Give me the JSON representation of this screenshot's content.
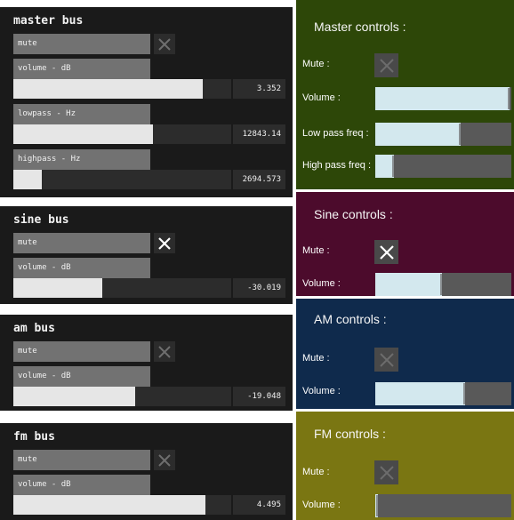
{
  "left_panels": [
    {
      "title": "master bus",
      "mute_label": "mute",
      "controls": [
        {
          "label": "volume - dB",
          "value": "3.352",
          "fill_fraction": 0.87
        },
        {
          "label": "lowpass - Hz",
          "value": "12843.14",
          "fill_fraction": 0.64
        },
        {
          "label": "highpass - Hz",
          "value": "2694.573",
          "fill_fraction": 0.13
        }
      ]
    },
    {
      "title": "sine bus",
      "mute_label": "mute",
      "controls": [
        {
          "label": "volume - dB",
          "value": "-30.019",
          "fill_fraction": 0.41
        }
      ]
    },
    {
      "title": "am bus",
      "mute_label": "mute",
      "controls": [
        {
          "label": "volume - dB",
          "value": "-19.048",
          "fill_fraction": 0.56
        }
      ]
    },
    {
      "title": "fm bus",
      "mute_label": "mute",
      "controls": [
        {
          "label": "volume - dB",
          "value": "4.495",
          "fill_fraction": 0.88
        }
      ]
    }
  ],
  "right_panels": [
    {
      "title": "Master controls :",
      "color": "#2d4708",
      "mute_label": "Mute :",
      "sliders": [
        {
          "label": "Volume :",
          "fill_fraction": 0.99
        },
        {
          "label": "Low pass freq :",
          "fill_fraction": 0.63
        },
        {
          "label": "High pass freq :",
          "fill_fraction": 0.14
        }
      ]
    },
    {
      "title": "Sine controls :",
      "color": "#4c0b2c",
      "mute_label": "Mute :",
      "sliders": [
        {
          "label": "Volume :",
          "fill_fraction": 0.49
        }
      ]
    },
    {
      "title": "AM controls :",
      "color": "#0f2a4c",
      "mute_label": "Mute :",
      "sliders": [
        {
          "label": "Volume :",
          "fill_fraction": 0.66
        }
      ]
    },
    {
      "title": "FM controls :",
      "color": "#7a7612",
      "mute_label": "Mute :",
      "sliders": [
        {
          "label": "Volume :",
          "fill_fraction": 0.02
        }
      ]
    }
  ]
}
